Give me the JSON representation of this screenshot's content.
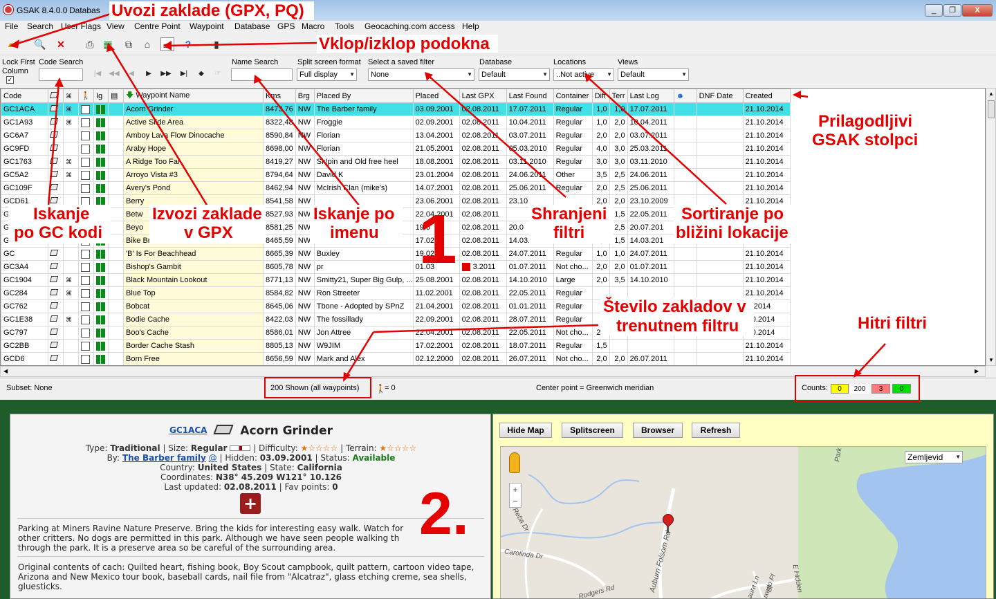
{
  "app": {
    "title": "GSAK 8.4.0.0",
    "title_suffix": "Databas"
  },
  "menu": [
    "File",
    "Search",
    "User Flags",
    "View",
    "Centre Point",
    "Waypoint",
    "Database",
    "GPS",
    "Macro",
    "Tools",
    "Geocaching.com access",
    "Help"
  ],
  "window_buttons": [
    "_",
    "❐",
    "X"
  ],
  "filter_bar": {
    "lock_label_1": "Lock First",
    "lock_label_2": "Column",
    "code_search_label": "Code Search",
    "name_search_label": "Name Search",
    "split_label": "Split screen format",
    "split_value": "Full display",
    "saved_filter_label": "Select a saved filter",
    "saved_filter_value": "None",
    "database_label": "Database",
    "database_value": "Default",
    "locations_label": "Locations",
    "locations_value": "..Not active",
    "views_label": "Views",
    "views_value": "Default"
  },
  "grid": {
    "columns": [
      "Code",
      "",
      "",
      "",
      "Ig",
      "",
      "Waypoint Name",
      "Kms",
      "Brg",
      "Placed By",
      "Placed",
      "Last GPX",
      "Last Found",
      "Container",
      "Diff",
      "Terr",
      "Last Log",
      "",
      "DNF Date",
      "Created"
    ],
    "rows": [
      [
        "GC1ACA",
        "Acorn Grinder",
        "8473,76",
        "NW",
        "The Barber family",
        "03.09.2001",
        "02.08.2011",
        "17.07.2011",
        "Regular",
        "1,0",
        "1,0",
        "17.07.2011",
        "",
        "21.10.2014"
      ],
      [
        "GC1A93",
        "Active Slide Area",
        "8322,48",
        "NW",
        "Froggie",
        "02.09.2001",
        "02.08.2011",
        "10.04.2011",
        "Regular",
        "1,0",
        "2,0",
        "10.04.2011",
        "",
        "21.10.2014"
      ],
      [
        "GC6A7",
        "Amboy Lava Flow Dinocache",
        "8590,84",
        "NW",
        "Florian",
        "13.04.2001",
        "02.08.2011",
        "03.07.2011",
        "Regular",
        "2,0",
        "2,0",
        "03.07.2011",
        "",
        "21.10.2014"
      ],
      [
        "GC9FD",
        "Araby Hope",
        "8698,00",
        "NW",
        "Florian",
        "21.05.2001",
        "02.08.2011",
        "05.03.2010",
        "Regular",
        "4,0",
        "3,0",
        "25.03.2011",
        "",
        "21.10.2014"
      ],
      [
        "GC1763",
        "A Ridge Too Far",
        "8419,27",
        "NW",
        "Sk!pin and Old free heel",
        "18.08.2001",
        "02.08.2011",
        "03.11.2010",
        "Regular",
        "3,0",
        "3,0",
        "03.11.2010",
        "",
        "21.10.2014"
      ],
      [
        "GC5A2",
        "Arroyo Vista #3",
        "8794,64",
        "NW",
        "David K",
        "23.01.2004",
        "02.08.2011",
        "24.06.2011",
        "Other",
        "3,5",
        "2,5",
        "24.06.2011",
        "",
        "21.10.2014"
      ],
      [
        "GC109F",
        "Avery's Pond",
        "8462,94",
        "NW",
        "McIrish Clan (mike's)",
        "14.07.2001",
        "02.08.2011",
        "25.06.2011",
        "Regular",
        "2,0",
        "2,5",
        "25.06.2011",
        "",
        "21.10.2014"
      ],
      [
        "GCD61",
        "Berry",
        "8541,58",
        "NW",
        "",
        "23.06.2001",
        "02.08.2011",
        "23.10",
        "",
        "2,0",
        "2,0",
        "23.10.2009",
        "",
        "21.10.2014"
      ],
      [
        "GC7A",
        "Betw",
        "8527,93",
        "NW",
        "",
        "22.04.2001",
        "02.08.2011",
        "",
        "",
        "",
        "1,5",
        "22.05.2011",
        "",
        "21.10.2014"
      ],
      [
        "GC",
        "Beyo",
        "8581,25",
        "NW",
        "",
        "19.0",
        "02.08.2011",
        "20.0",
        "",
        "",
        "2,5",
        "20.07.201",
        "",
        "21.10.2014"
      ],
      [
        "GC",
        "Bike Break",
        "8465,59",
        "NW",
        "T",
        "17.02",
        "02.08.2011",
        "14.03.201",
        "",
        "1,5",
        "1,5",
        "14.03.201",
        "",
        "21.10.2014"
      ],
      [
        "GC",
        "'B' Is For Beachhead",
        "8665,39",
        "NW",
        "Buxley",
        "19.02",
        "02.08.2011",
        "24.07.2011",
        "Regular",
        "1,0",
        "1,0",
        "24.07.2011",
        "",
        "21.10.2014"
      ],
      [
        "GC3A4",
        "Bishop's Gambit",
        "8605,78",
        "NW",
        "pr",
        "01.03",
        "3.2011",
        "01.07.2011",
        "Not cho...",
        "2,0",
        "2,0",
        "01.07.2011",
        "",
        "21.10.2014"
      ],
      [
        "GC1904",
        "Black Mountain Lookout",
        "8771,13",
        "NW",
        "Smitty21, Super Big Gulp, ...",
        "25.08.2001",
        "02.08.2011",
        "14.10.2010",
        "Large",
        "2,0",
        "3,5",
        "14.10.2010",
        "",
        "21.10.2014"
      ],
      [
        "GC284",
        "Blue Top",
        "8584,82",
        "NW",
        "Ron Streeter",
        "11.02.2001",
        "02.08.2011",
        "22.05.2011",
        "Regular",
        "",
        "",
        "",
        "",
        "21.10.2014"
      ],
      [
        "GC762",
        "Bobcat",
        "8645,06",
        "NW",
        "Tbone - Adopted by SPnZ",
        "21.04.2001",
        "02.08.2011",
        "01.01.2011",
        "Regular",
        "",
        "",
        "",
        "",
        ".0.2014"
      ],
      [
        "GC1E38",
        "Bodie Cache",
        "8422,03",
        "NW",
        "The fossillady",
        "22.09.2001",
        "02.08.2011",
        "28.07.2011",
        "Regular",
        "",
        "",
        "",
        "",
        ".10.2014"
      ],
      [
        "GC797",
        "Boo's Cache",
        "8586,01",
        "NW",
        "Jon Attree",
        "22.04.2001",
        "02.08.2011",
        "22.05.2011",
        "Not cho...",
        "2,0",
        "",
        "",
        "",
        ".10.2014"
      ],
      [
        "GC2BB",
        "Border Cache Stash",
        "8805,13",
        "NW",
        "W9JIM",
        "17.02.2001",
        "02.08.2011",
        "18.07.2011",
        "Regular",
        "1,5",
        "",
        "",
        "",
        "21.10.2014"
      ],
      [
        "GCD6",
        "Born Free",
        "8656,59",
        "NW",
        "Mark and Alex",
        "02.12.2000",
        "02.08.2011",
        "26.07.2011",
        "Not cho...",
        "2,0",
        "2,0",
        "26.07.2011",
        "",
        "21.10.2014"
      ]
    ]
  },
  "status": {
    "subset": "Subset: None",
    "shown": "200 Shown (all waypoints)",
    "person_count": "= 0",
    "center": "Center point = Greenwich meridian",
    "counts_label": "Counts:",
    "count_yellow": "0",
    "count_total": "200",
    "count_red": "3",
    "count_green": "0"
  },
  "detail": {
    "code": "GC1ACA",
    "name": "Acorn Grinder",
    "line_type_prefix": "Type: ",
    "type": "Traditional",
    "size_prefix": " | Size: ",
    "size": "Regular",
    "difficulty_label": " | Difficulty: ",
    "terrain_label": " | Terrain: ",
    "by_prefix": "By: ",
    "owner": "The Barber family",
    "owner_at": "@",
    "hidden_prefix": " | Hidden: ",
    "hidden": "03.09.2001",
    "status_prefix": " | Status: ",
    "status": "Available",
    "country_prefix": "Country: ",
    "country": "United States",
    "state_prefix": " | State: ",
    "state": "California",
    "coords_prefix": "Coordinates: ",
    "coords": "N38° 45.209 W121° 10.126",
    "updated_prefix": "Last updated: ",
    "updated": "02.08.2011",
    "fav_prefix": " | Fav points: ",
    "fav": "0",
    "paragraph1": "Parking at Miners Ravine Nature Preserve. Bring the kids for interesting easy walk. Watch for other critters. No dogs are permitted in this park. Although we have seen people walking th through the park. It is a preserve area so be careful of the surrounding area.",
    "paragraph2": "Original contents of cach: Quilted heart, fishing book, Boy Scout campbook, quilt pattern, cartoon video tape, Arizona and New Mexico tour book, baseball cards, nail file from \"Alcatraz\", glass etching creme, sea shells, gluesticks."
  },
  "map_pane": {
    "buttons": [
      "Hide Map",
      "Splitscreen",
      "Browser",
      "Refresh"
    ],
    "map_type": "Zemljevid",
    "zoom_in": "+",
    "zoom_out": "−",
    "streets": [
      "Reba Dr",
      "Carolinda Dr",
      "Auburn Folsom Rd",
      "Park",
      "Rodgers Rd",
      "E Hidden",
      "Laura Ln",
      "Tuxedo Pl",
      "Bl"
    ]
  },
  "annotations": {
    "uvozi": "Uvozi zaklade (GPX, PQ)",
    "vklop": "Vklop/izklop podokna",
    "prilagodljivi_1": "Prilagodljivi",
    "prilagodljivi_2": "GSAK stolpci",
    "iskanje_gc_1": "Iskanje",
    "iskanje_gc_2": "po GC kodi",
    "izvozi_1": "Izvozi zaklade",
    "izvozi_2": "v GPX",
    "iskanje_ime_1": "Iskanje po",
    "iskanje_ime_2": "imenu",
    "shranjeni_1": "Shranjeni",
    "shranjeni_2": "filtri",
    "sortiranje_1": "Sortiranje po",
    "sortiranje_2": "bližini lokacije",
    "stevilo_1": "Število zakladov v",
    "stevilo_2": "trenutnem filtru",
    "hitri": "Hitri filtri",
    "num_1": "1",
    "num_2": "2."
  },
  "colors": {
    "selected_row": "#3fe0e6",
    "name_col": "#fffbd8",
    "annotation_red": "#e50000",
    "split_bg": "#1f5c2c"
  }
}
